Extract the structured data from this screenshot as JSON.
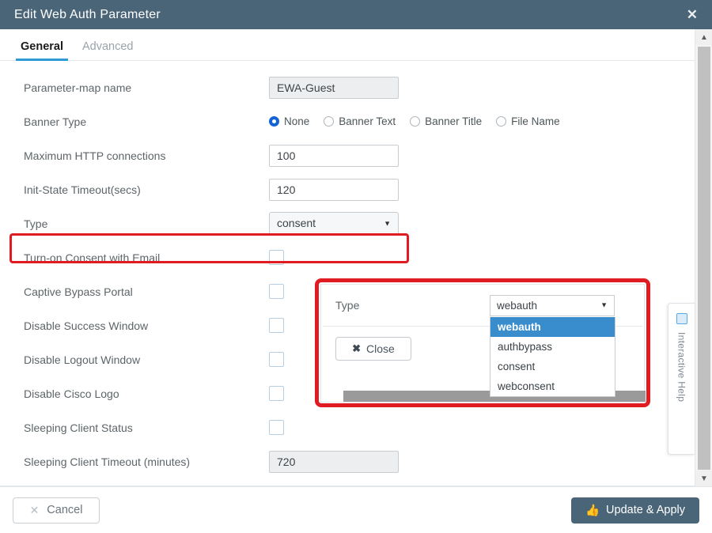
{
  "window": {
    "title": "Edit Web Auth Parameter",
    "close_icon": "close-icon"
  },
  "tabs": [
    {
      "label": "General",
      "active": true
    },
    {
      "label": "Advanced",
      "active": false
    }
  ],
  "form": {
    "parameter_map_name": {
      "label": "Parameter-map name",
      "value": "EWA-Guest"
    },
    "banner_type": {
      "label": "Banner Type",
      "options": [
        "None",
        "Banner Text",
        "Banner Title",
        "File Name"
      ],
      "selected": "None"
    },
    "max_http_connections": {
      "label": "Maximum HTTP connections",
      "value": "100"
    },
    "init_state_timeout": {
      "label": "Init-State Timeout(secs)",
      "value": "120"
    },
    "type": {
      "label": "Type",
      "value": "consent",
      "caret_icon": "chevron-down-icon",
      "highlighted": true
    },
    "checkboxes": [
      {
        "label": "Turn-on Consent with Email",
        "checked": false
      },
      {
        "label": "Captive Bypass Portal",
        "checked": false
      },
      {
        "label": "Disable Success Window",
        "checked": false
      },
      {
        "label": "Disable Logout Window",
        "checked": false
      },
      {
        "label": "Disable Cisco Logo",
        "checked": false
      },
      {
        "label": "Sleeping Client Status",
        "checked": false
      }
    ],
    "sleeping_client_timeout": {
      "label": "Sleeping Client Timeout (minutes)",
      "value": "720"
    }
  },
  "overlay": {
    "type_label": "Type",
    "type_value": "webauth",
    "caret_icon": "chevron-down-icon",
    "dropdown_options": [
      {
        "label": "webauth",
        "selected": true
      },
      {
        "label": "authbypass",
        "selected": false
      },
      {
        "label": "consent",
        "selected": false
      },
      {
        "label": "webconsent",
        "selected": false
      }
    ],
    "close_button": {
      "label": "Close",
      "icon": "close-icon"
    }
  },
  "side_panel": {
    "label": "Interactive Help",
    "icon": "help-panel-icon"
  },
  "scrollbar": {
    "up_icon": "chevron-up-icon",
    "down_icon": "chevron-down-icon"
  },
  "footer": {
    "cancel": {
      "label": "Cancel",
      "icon": "close-icon"
    },
    "apply": {
      "label": "Update & Apply",
      "icon": "thumbs-up-icon"
    }
  },
  "colors": {
    "header": "#4a6578",
    "accent_blue": "#2f9bd6",
    "highlight_blue": "#3a8dcc",
    "annotation_red": "#e01b22",
    "radio_blue": "#1463d6"
  }
}
